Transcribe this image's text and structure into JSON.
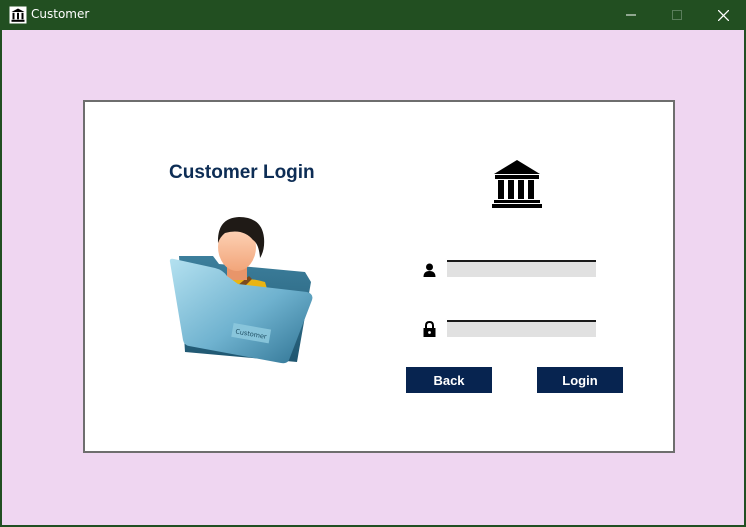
{
  "window": {
    "title": "Customer",
    "app_icon": "bank-icon",
    "controls": {
      "minimize": "minimize-icon",
      "maximize": "maximize-icon",
      "close": "close-icon"
    }
  },
  "colors": {
    "titlebar": "#224f21",
    "background": "#efd6f1",
    "panel": "#ffffff",
    "heading": "#0d2d55",
    "button": "#072450",
    "input": "#e1e1e1"
  },
  "login": {
    "heading": "Customer Login",
    "illustration": {
      "icon": "customer-folder-icon",
      "folder_label": "Customer"
    },
    "logo_icon": "bank-icon",
    "username": {
      "icon": "user-icon",
      "value": "",
      "placeholder": ""
    },
    "password": {
      "icon": "lock-icon",
      "value": "",
      "placeholder": ""
    },
    "back_label": "Back",
    "login_label": "Login"
  }
}
